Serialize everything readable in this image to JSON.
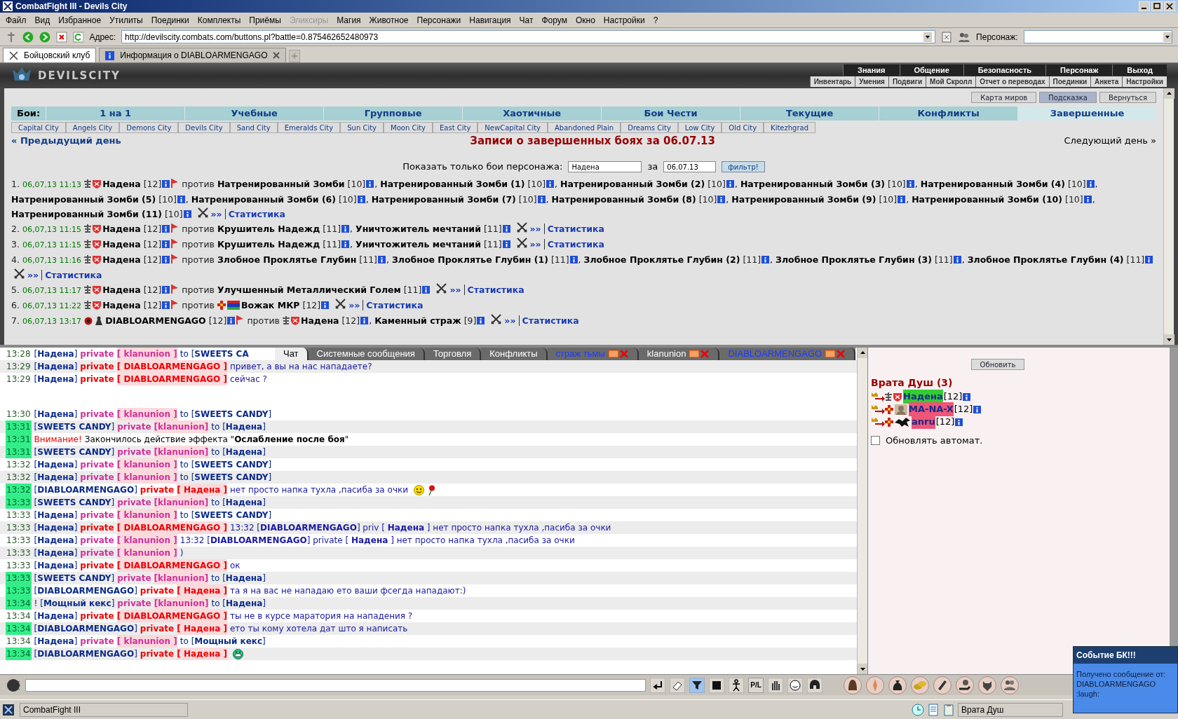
{
  "window": {
    "title": "CombatFight III - Devils City"
  },
  "menu": [
    {
      "label": "Файл",
      "disabled": false
    },
    {
      "label": "Вид",
      "disabled": false
    },
    {
      "label": "Избранное",
      "disabled": false
    },
    {
      "label": "Утилиты",
      "disabled": false
    },
    {
      "label": "Поединки",
      "disabled": false
    },
    {
      "label": "Комплекты",
      "disabled": false
    },
    {
      "label": "Приёмы",
      "disabled": false
    },
    {
      "label": "Эликсиры",
      "disabled": true
    },
    {
      "label": "Магия",
      "disabled": false
    },
    {
      "label": "Животное",
      "disabled": false
    },
    {
      "label": "Персонажи",
      "disabled": false
    },
    {
      "label": "Навигация",
      "disabled": false
    },
    {
      "label": "Чат",
      "disabled": false
    },
    {
      "label": "Форум",
      "disabled": false
    },
    {
      "label": "Окно",
      "disabled": false
    },
    {
      "label": "Настройки",
      "disabled": false
    },
    {
      "label": "?",
      "disabled": false
    }
  ],
  "address_bar": {
    "label": "Адрес:",
    "url": "http://devilscity.combats.com/buttons.pl?battle=0.875462652480973",
    "character_label": "Персонаж:"
  },
  "browser_tabs": [
    {
      "label": "Бойцовский клуб",
      "selected": true
    },
    {
      "label": "Информация о DIABLOARMENGAGO",
      "selected": false
    }
  ],
  "game_header": {
    "logo": "DEVILSCITY",
    "nav_primary": [
      "Знания",
      "Общение",
      "Безопасность",
      "Персонаж",
      "Выход"
    ],
    "nav_secondary": [
      "Инвентарь",
      "Умения",
      "Подвиги",
      "Мой Скролл",
      "Отчет о переводах",
      "Поединки",
      "Анкета",
      "Настройки"
    ]
  },
  "battles_page": {
    "buttons": [
      {
        "label": "Карта миров",
        "selected": false
      },
      {
        "label": "Подсказка",
        "selected": true
      },
      {
        "label": "Вернуться",
        "selected": false
      }
    ],
    "category_label": "Бои:",
    "categories": [
      {
        "label": "1 на 1",
        "selected": false
      },
      {
        "label": "Учебные",
        "selected": false
      },
      {
        "label": "Групповые",
        "selected": false
      },
      {
        "label": "Хаотичные",
        "selected": false
      },
      {
        "label": "Бои Чести",
        "selected": false
      },
      {
        "label": "Текущие",
        "selected": false
      },
      {
        "label": "Конфликты",
        "selected": false
      },
      {
        "label": "Завершенные",
        "selected": true
      }
    ],
    "cities": [
      "Capital City",
      "Angels City",
      "Demons City",
      "Devils City",
      "Sand City",
      "Emeralds City",
      "Sun City",
      "Moon City",
      "East City",
      "NewCapital City",
      "Abandoned Plain",
      "Dreams City",
      "Low City",
      "Old City",
      "Kitezhgrad"
    ],
    "prev_day": "« Предыдущий день",
    "title": "Записи о завершенных боях за 06.07.13",
    "next_day": "Следующий день »",
    "filter": {
      "label": "Показать только бои персонажа:",
      "name_value": "Надена",
      "date_label": "за",
      "date_value": "06.07.13",
      "button": "фильтр!"
    },
    "battles": [
      {
        "number": "1.",
        "time": "06,07,13 11:13",
        "side_a": [
          {
            "name": "Надена",
            "level": "[12]",
            "badges": [
              {
                "kind": "totem"
              },
              {
                "kind": "shield"
              }
            ]
          }
        ],
        "versus": "против",
        "side_b": [
          {
            "name": "Натренированный Зомби",
            "level": "[10]",
            "punct": ","
          },
          {
            "name": "Натренированный Зомби (1)",
            "level": "[10]",
            "punct": ","
          },
          {
            "name": "Натренированный Зомби (2)",
            "level": "[10]",
            "punct": ","
          },
          {
            "name": "Натренированный Зомби (3)",
            "level": "[10]",
            "punct": ","
          },
          {
            "name": "Натренированный Зомби (4)",
            "level": "[10]",
            "punct": ","
          },
          {
            "name": "Натренированный Зомби (5)",
            "level": "[10]",
            "punct": ","
          },
          {
            "name": "Натренированный Зомби (6)",
            "level": "[10]",
            "punct": ","
          },
          {
            "name": "Натренированный Зомби (7)",
            "level": "[10]",
            "punct": ","
          },
          {
            "name": "Натренированный Зомби (8)",
            "level": "[10]",
            "punct": ","
          },
          {
            "name": "Натренированный Зомби (9)",
            "level": "[10]",
            "punct": ","
          },
          {
            "name": "Натренированный Зомби (10)",
            "level": "[10]",
            "punct": ","
          },
          {
            "name": "Натренированный Зомби (11)",
            "level": "[10]"
          }
        ],
        "log_link": "»»",
        "stats_link": "Статистика"
      },
      {
        "number": "2.",
        "time": "06,07,13 11:15",
        "side_a": [
          {
            "name": "Надена",
            "level": "[12]",
            "badges": [
              {
                "kind": "totem"
              },
              {
                "kind": "shield"
              }
            ]
          }
        ],
        "versus": "против",
        "side_b": [
          {
            "name": "Крушитель Надежд",
            "level": "[11]",
            "punct": ","
          },
          {
            "name": "Уничтожитель мечтаний",
            "level": "[11]"
          }
        ],
        "log_link": "»»",
        "stats_link": "Статистика"
      },
      {
        "number": "3.",
        "time": "06,07,13 11:15",
        "side_a": [
          {
            "name": "Надена",
            "level": "[12]",
            "badges": [
              {
                "kind": "totem"
              },
              {
                "kind": "shield"
              }
            ]
          }
        ],
        "versus": "против",
        "side_b": [
          {
            "name": "Крушитель Надежд",
            "level": "[11]",
            "punct": ","
          },
          {
            "name": "Уничтожитель мечтаний",
            "level": "[11]"
          }
        ],
        "log_link": "»»",
        "stats_link": "Статистика"
      },
      {
        "number": "4.",
        "time": "06,07,13 11:16",
        "side_a": [
          {
            "name": "Надена",
            "level": "[12]",
            "badges": [
              {
                "kind": "totem"
              },
              {
                "kind": "shield"
              }
            ]
          }
        ],
        "versus": "против",
        "side_b": [
          {
            "name": "Злобное Проклятье Глубин",
            "level": "[11]",
            "punct": ","
          },
          {
            "name": "Злобное Проклятье Глубин (1)",
            "level": "[11]",
            "punct": ","
          },
          {
            "name": "Злобное Проклятье Глубин (2)",
            "level": "[11]",
            "punct": ","
          },
          {
            "name": "Злобное Проклятье Глубин (3)",
            "level": "[11]",
            "punct": ","
          },
          {
            "name": "Злобное Проклятье Глубин (4)",
            "level": "[11]"
          }
        ],
        "log_link": "»»",
        "stats_link": "Статистика"
      },
      {
        "number": "5.",
        "time": "06,07,13 11:17",
        "side_a": [
          {
            "name": "Надена",
            "level": "[12]",
            "badges": [
              {
                "kind": "totem"
              },
              {
                "kind": "shield"
              }
            ]
          }
        ],
        "versus": "против",
        "side_b": [
          {
            "name": "Улучшенный Металлический Голем",
            "level": "[11]"
          }
        ],
        "log_link": "»»",
        "stats_link": "Статистика"
      },
      {
        "number": "6.",
        "time": "06,07,13 11:22",
        "side_a": [
          {
            "name": "Надена",
            "level": "[12]",
            "badges": [
              {
                "kind": "totem"
              },
              {
                "kind": "shield"
              }
            ]
          }
        ],
        "versus": "против",
        "side_b": [
          {
            "name": "Вожак МКР",
            "level": "[12]",
            "badges": [
              {
                "kind": "cross"
              },
              {
                "kind": "banner"
              }
            ]
          }
        ],
        "log_link": "»»",
        "stats_link": "Статистика"
      },
      {
        "number": "7.",
        "time": "06,07,13 13:17",
        "side_a": [
          {
            "name": "DIABLOARMENGAGO",
            "level": "[12]",
            "badges": [
              {
                "kind": "orb"
              },
              {
                "kind": "figure"
              }
            ]
          }
        ],
        "versus": "против",
        "side_b": [
          {
            "name": "Надена",
            "level": "[12]",
            "badges": [
              {
                "kind": "totem"
              },
              {
                "kind": "shield"
              }
            ],
            "punct": ","
          },
          {
            "name": "Каменный страж",
            "level": "[9]"
          }
        ],
        "log_link": "»»",
        "stats_link": "Статистика"
      }
    ]
  },
  "chat": {
    "tabs": [
      {
        "label": "Чат",
        "selected": true,
        "closable": false
      },
      {
        "label": "Системные сообщения",
        "selected": false,
        "closable": false
      },
      {
        "label": "Торговля",
        "selected": false,
        "closable": false
      },
      {
        "label": "Конфликты",
        "selected": false,
        "closable": false
      },
      {
        "label": "страж тьмы",
        "selected": false,
        "closable": true,
        "highlighted": false
      },
      {
        "label": "klanunion",
        "selected": false,
        "closable": true,
        "highlighted": true
      },
      {
        "label": "DIABLOARMENGAGO",
        "selected": false,
        "closable": true,
        "highlighted": false
      }
    ],
    "messages": [
      {
        "kind": "private",
        "time": "13:28",
        "new": false,
        "from": "[**Надена**]",
        "label": "private",
        "channel": "[ klanunion ]",
        "direct": false,
        "to": "to [**SWEETS CA**"
      },
      {
        "kind": "private",
        "time": "13:29",
        "new": false,
        "from": "[**Надена**]",
        "label": "private",
        "channel": "[ DIABLOARMENGAGO ]",
        "direct": true,
        "text": "привет, а вы на нас нападаете?"
      },
      {
        "kind": "private",
        "time": "13:29",
        "new": false,
        "from": "[**Надена**]",
        "label": "private",
        "channel": "[ DIABLOARMENGAGO ]",
        "direct": true,
        "text": "сейчас ?"
      },
      {
        "kind": "redacted"
      },
      {
        "kind": "private",
        "time": "13:30",
        "new": false,
        "from": "[**Надена**]",
        "label": "private",
        "channel": "[ klanunion ]",
        "direct": false,
        "to": "to [**SWEETS CANDY**]"
      },
      {
        "kind": "private",
        "time": "13:31",
        "new": true,
        "from": "[**SWEETS CANDY**]",
        "label": "private",
        "channel": "[klanunion]",
        "direct": false,
        "to": "to [**Надена**]"
      },
      {
        "kind": "system",
        "time": "13:31",
        "new": true,
        "alert": "Внимание!",
        "text": "Закончилось действие эффекта \"**Ослабление после боя**\""
      },
      {
        "kind": "private",
        "time": "13:31",
        "new": true,
        "from": "[**SWEETS CANDY**]",
        "label": "private",
        "channel": "[klanunion]",
        "direct": false,
        "to": "to [**Надена**]"
      },
      {
        "kind": "private",
        "time": "13:32",
        "new": false,
        "from": "[**Надена**]",
        "label": "private",
        "channel": "[ klanunion ]",
        "direct": false,
        "to": "to [**SWEETS CANDY**]"
      },
      {
        "kind": "private",
        "time": "13:32",
        "new": false,
        "from": "[**Надена**]",
        "label": "private",
        "channel": "[ klanunion ]",
        "direct": false,
        "to": "to [**SWEETS CANDY**]"
      },
      {
        "kind": "private",
        "time": "13:32",
        "new": true,
        "from": "[**DIABLOARMENGAGO**]",
        "label": "private",
        "channel": "[ Надена ]",
        "direct": true,
        "text": "нет просто напка тухла ,пасиба за очки",
        "emotes": [
          {
            "kind": "smile"
          },
          {
            "kind": "rose"
          }
        ]
      },
      {
        "kind": "private",
        "time": "13:33",
        "new": true,
        "from": "[**SWEETS CANDY**]",
        "label": "private",
        "channel": "[klanunion]",
        "direct": false,
        "to": "to [**Надена**]"
      },
      {
        "kind": "private",
        "time": "13:33",
        "new": false,
        "from": "[**Надена**]",
        "label": "private",
        "channel": "[ klanunion ]",
        "direct": false,
        "to": "to [**SWEETS CANDY**]"
      },
      {
        "kind": "private",
        "time": "13:33",
        "new": false,
        "from": "[**Надена**]",
        "label": "private",
        "channel": "[ DIABLOARMENGAGO ]",
        "direct": true,
        "text": "13:32 [**DIABLOARMENGAGO**] priv [ **Надена** ] нет просто напка тухла ,пасиба за очки"
      },
      {
        "kind": "private",
        "time": "13:33",
        "new": false,
        "from": "[**Надена**]",
        "label": "private",
        "channel": "[ klanunion ]",
        "direct": false,
        "text": "13:32 [**DIABLOARMENGAGO**] private [ **Надена** ] нет просто напка тухла ,пасиба за очки"
      },
      {
        "kind": "private",
        "time": "13:33",
        "new": false,
        "from": "[**Надена**]",
        "label": "private",
        "channel": "[ klanunion ]",
        "direct": false,
        "text": ")"
      },
      {
        "kind": "private",
        "time": "13:33",
        "new": false,
        "from": "[**Надена**]",
        "label": "private",
        "channel": "[ DIABLOARMENGAGO ]",
        "direct": true,
        "text": "ок"
      },
      {
        "kind": "private",
        "time": "13:33",
        "new": true,
        "from": "[**SWEETS CANDY**]",
        "label": "private",
        "channel": "[klanunion]",
        "direct": false,
        "to": "to [**Надена**]"
      },
      {
        "kind": "private",
        "time": "13:33",
        "new": true,
        "from": "[**DIABLOARMENGAGO**]",
        "label": "private",
        "channel": "[ Надена ]",
        "direct": true,
        "text": "та я на вас не нападаю ето ваши фсегда нападают:)"
      },
      {
        "kind": "private",
        "time": "13:34",
        "new": true,
        "from": "! [**Мощный кекс**]",
        "label": "private",
        "channel": "[klanunion]",
        "direct": false,
        "to": "to [**Надена**]"
      },
      {
        "kind": "private",
        "time": "13:34",
        "new": false,
        "from": "[**Надена**]",
        "label": "private",
        "channel": "[ DIABLOARMENGAGO ]",
        "direct": true,
        "text": "ты не в курсе маратория на нападения ?"
      },
      {
        "kind": "private",
        "time": "13:34",
        "new": true,
        "from": "[**DIABLOARMENGAGO**]",
        "label": "private",
        "channel": "[ Надена ]",
        "direct": true,
        "text": "ето ты кому хотела дат што я написать"
      },
      {
        "kind": "private",
        "time": "13:34",
        "new": false,
        "from": "[**Надена**]",
        "label": "private",
        "channel": "[ klanunion ]",
        "direct": false,
        "to": "to [**Мощный кекс**]"
      },
      {
        "kind": "private",
        "time": "13:34",
        "new": true,
        "from": "[**DIABLOARMENGAGO**]",
        "label": "private",
        "channel": "[ Надена ]",
        "direct": true,
        "emotes": [
          {
            "kind": "grin"
          }
        ]
      }
    ]
  },
  "toolbar": {
    "pl_label": "P/L"
  },
  "room_panel": {
    "refresh_button": "Обновить",
    "title": "Врата Душ (3)",
    "members": [
      {
        "name": "Надена",
        "level": "[12]",
        "color": "#33cc33",
        "badges": [
          {
            "kind": "totem"
          },
          {
            "kind": "shield"
          }
        ]
      },
      {
        "name": "MA-NA-X",
        "level": "[12]",
        "color": "#ee5577",
        "badges": [
          {
            "kind": "cross"
          },
          {
            "kind": "portrait"
          }
        ]
      },
      {
        "name": "anru",
        "level": "[12]",
        "color": "#ee5577",
        "badges": [
          {
            "kind": "cross"
          },
          {
            "kind": "beast"
          }
        ]
      }
    ],
    "auto_refresh": {
      "label": "Обновлять автомат.",
      "checked": false
    }
  },
  "status_bar": {
    "app": "CombatFight III",
    "location": "Врата Душ"
  },
  "notification": {
    "title": "Событие БК!!!",
    "line": "Получено сообщение от:",
    "sender": "DIABLOARMENGAGO",
    "text": ":laugh:"
  }
}
